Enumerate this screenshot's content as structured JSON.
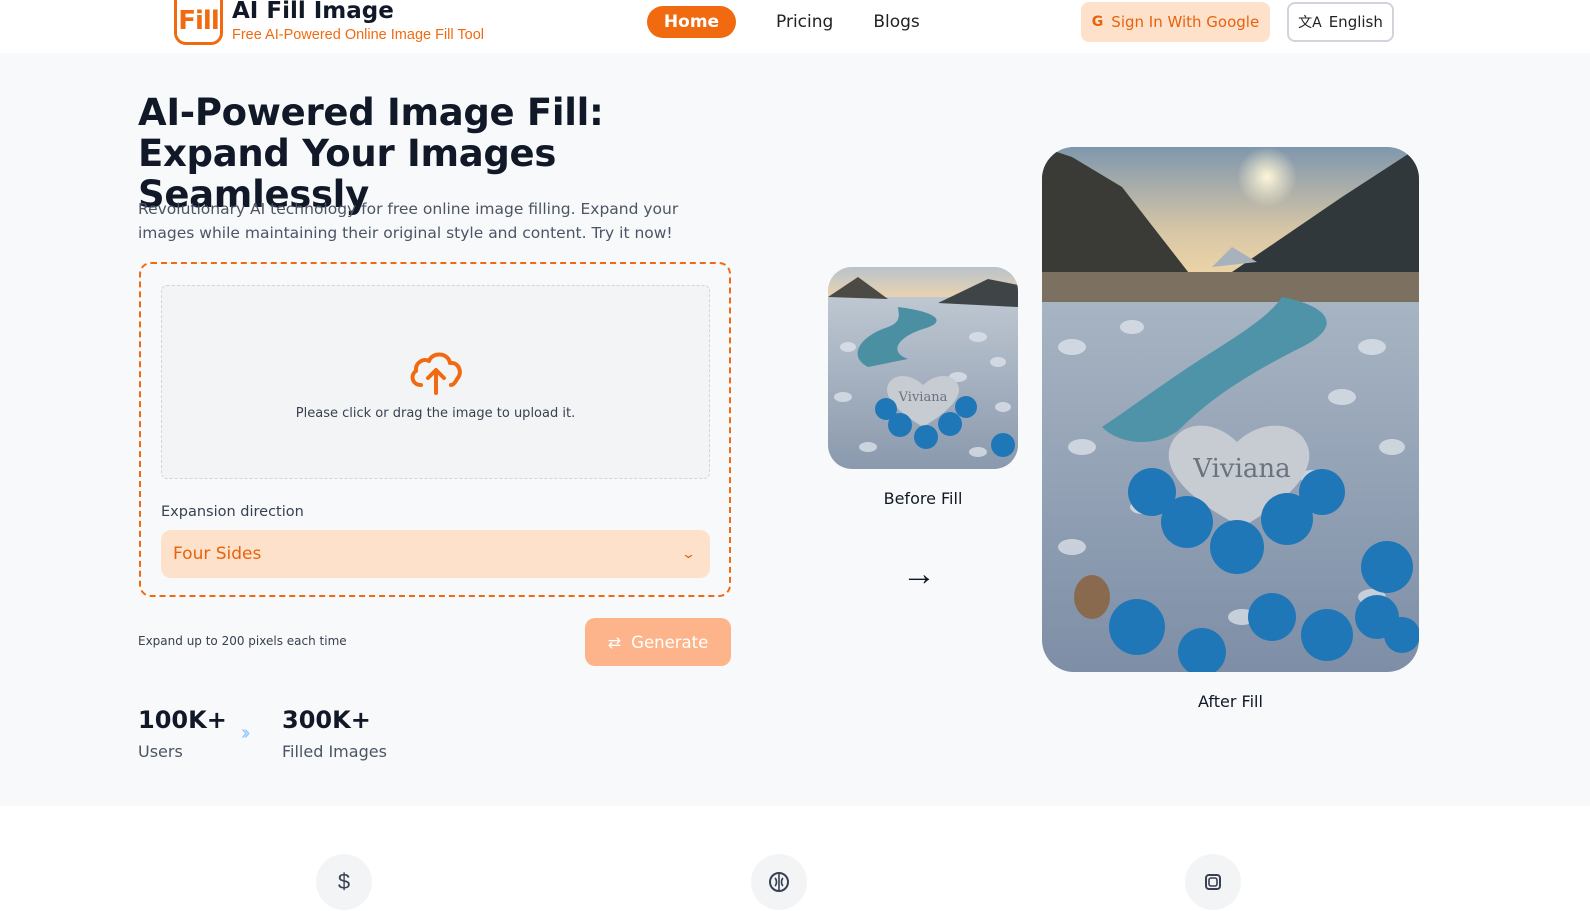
{
  "header": {
    "brand_title": "AI Fill Image",
    "brand_subtitle": "Free AI-Powered Online Image Fill Tool",
    "logo_text": "Fill",
    "nav": [
      {
        "label": "Home",
        "active": true
      },
      {
        "label": "Pricing",
        "active": false
      },
      {
        "label": "Blogs",
        "active": false
      }
    ],
    "signin_label": "Sign In With Google",
    "language_label": "English"
  },
  "hero": {
    "title": "AI-Powered Image Fill: Expand Your Images Seamlessly",
    "description": "Revolutionary AI technology for free online image filling. Expand your images while maintaining their original style and content. Try it now!"
  },
  "upload": {
    "dropzone_text": "Please click or drag the image to upload it.",
    "expansion_label": "Expansion direction",
    "expansion_value": "Four Sides",
    "note": "Expand up to 200 pixels each time",
    "generate_label": "Generate"
  },
  "stats": [
    {
      "value": "100K+",
      "label": "Users"
    },
    {
      "value": "300K+",
      "label": "Filled Images"
    }
  ],
  "images": {
    "before_label": "Before Fill",
    "after_label": "After Fill",
    "stone_text": "Viviana"
  },
  "colors": {
    "accent": "#f26a10",
    "accent_light": "#fde1cb",
    "generate_bg": "#fdb48a"
  },
  "features": {
    "icons": [
      "dollar-icon",
      "brain-icon",
      "layers-icon"
    ]
  }
}
